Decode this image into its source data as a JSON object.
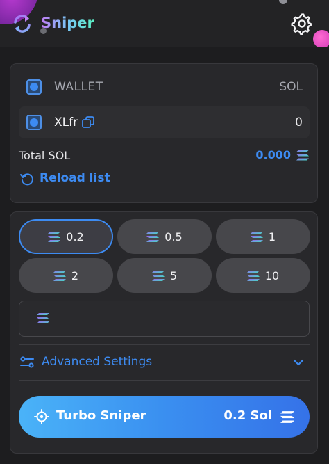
{
  "header": {
    "brand": "Sniper"
  },
  "wallets": {
    "header_label": "WALLET",
    "header_value_label": "SOL",
    "items": [
      {
        "name": "XLfr",
        "balance": "0"
      }
    ],
    "total_label": "Total SOL",
    "total_value": "0.000",
    "reload_label": "Reload list"
  },
  "amounts": {
    "options": [
      "0.2",
      "0.5",
      "1",
      "2",
      "5",
      "10"
    ],
    "selected": "0.2",
    "custom_value": ""
  },
  "advanced": {
    "label": "Advanced Settings"
  },
  "turbo": {
    "label": "Turbo Sniper",
    "amount": "0.2 Sol"
  },
  "colors": {
    "accent": "#3d8bf2",
    "background": "#1d1d1f",
    "card": "#28282b"
  }
}
